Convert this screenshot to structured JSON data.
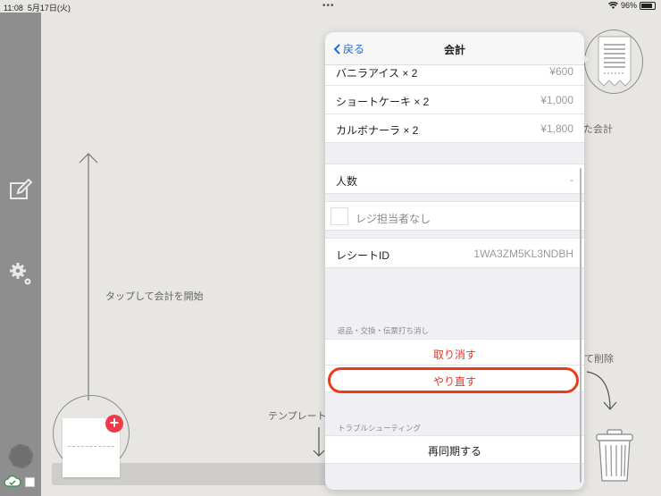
{
  "statusbar": {
    "time": "11:08",
    "date": "5月17日(火)",
    "battery": "96%",
    "dots": "•••"
  },
  "canvas": {
    "tap_hint": "タップして会計を開始",
    "template_hint": "テンプレート",
    "delete_hint": "て削除",
    "receipt_hint": "た会計"
  },
  "popover": {
    "back_label": "戻る",
    "title": "会計",
    "items": [
      {
        "name": "バニラアイス × 2",
        "price": "¥600"
      },
      {
        "name": "ショートケーキ × 2",
        "price": "¥1,000"
      },
      {
        "name": "カルボナーラ × 2",
        "price": "¥1,800"
      }
    ],
    "people_label": "人数",
    "people_value": "-",
    "cashier_label": "レジ担当者なし",
    "receipt_id_label": "レシートID",
    "receipt_id_value": "1WA3ZM5KL3NDBH",
    "section_returns": "返品・交換・伝票打ち消し",
    "cancel_label": "取り消す",
    "redo_label": "やり直す",
    "section_trouble": "トラブルシューティング",
    "resync_label": "再同期する"
  },
  "colors": {
    "accent_blue": "#1a6fe0",
    "destructive_red": "#e8332a",
    "highlight_ring": "#ee3a1a",
    "add_badge": "#f03a4a"
  }
}
